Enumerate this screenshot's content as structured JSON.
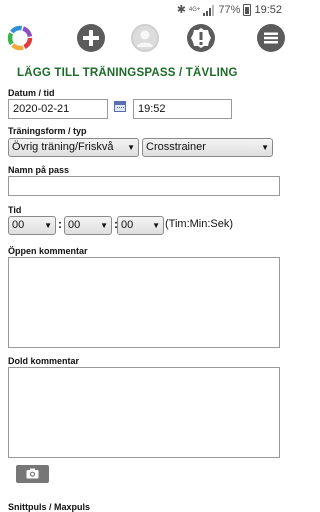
{
  "statusbar": {
    "bluetooth": "✱",
    "network": "4G+",
    "signal_icon": "signal-icon",
    "battery": "77%",
    "time": "19:52"
  },
  "topbar": {
    "icons": [
      "app-logo-icon",
      "plus-icon",
      "avatar-icon",
      "alert-icon",
      "menu-icon"
    ]
  },
  "form": {
    "heading": "LÄGG TILL TRÄNINGSPASS / TÄVLING",
    "date_label": "Datum / tid",
    "date_value": "2020-02-21",
    "time_value": "19:52",
    "type_label": "Träningsform / typ",
    "type_value": "Övrig träning/Friskvå",
    "subtype_value": "Crosstrainer",
    "name_label": "Namn på pass",
    "name_value": "",
    "duration_label": "Tid",
    "hours": "00",
    "minutes": "00",
    "seconds": "00",
    "separator": ":",
    "duration_hint": "(Tim:Min:Sek)",
    "open_comment_label": "Öppen kommentar",
    "hidden_comment_label": "Dold kommentar",
    "pulse_label": "Snittpuls / Maxpuls"
  },
  "colors": {
    "heading": "#1d6b28",
    "icon_dark": "#5b5b5b"
  }
}
